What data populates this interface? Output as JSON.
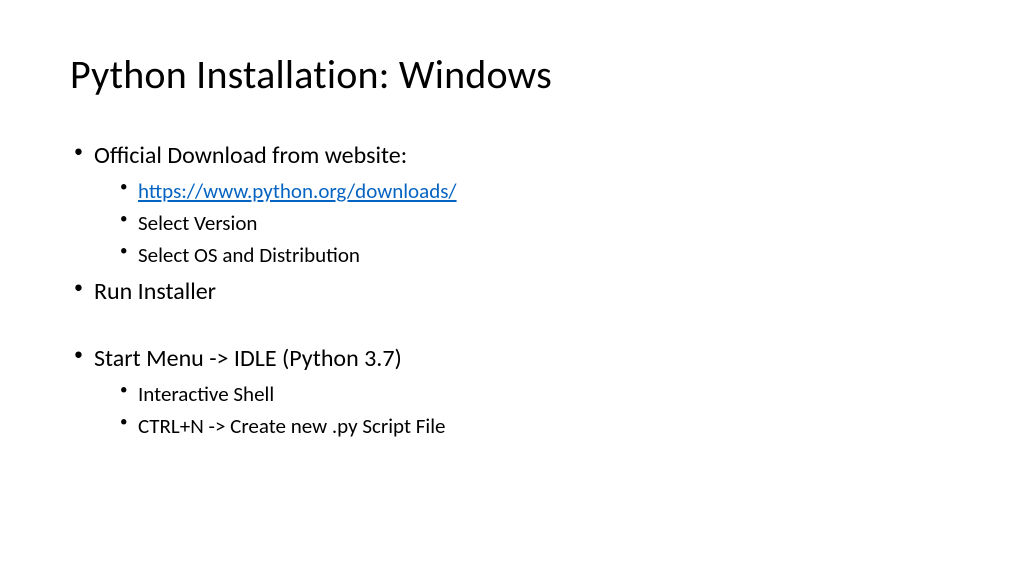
{
  "slide": {
    "title": "Python Installation: Windows",
    "bullets": [
      {
        "text": "Official Download from website:",
        "sub": [
          {
            "text": "https://www.python.org/downloads/",
            "link": true
          },
          {
            "text": "Select Version"
          },
          {
            "text": "Select OS and Distribution"
          }
        ]
      },
      {
        "text": "Run Installer"
      },
      {
        "gap": true
      },
      {
        "text": "Start Menu -> IDLE (Python 3.7)",
        "sub": [
          {
            "text": "Interactive Shell"
          },
          {
            "text": "CTRL+N -> Create new .py Script File"
          }
        ]
      }
    ]
  }
}
